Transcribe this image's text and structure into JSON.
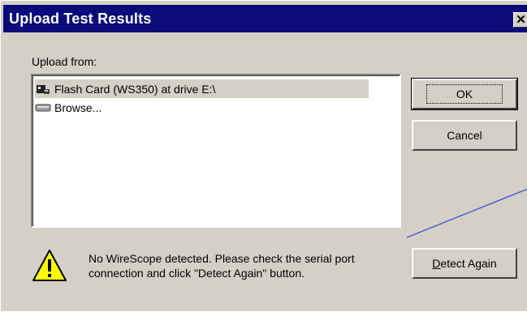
{
  "dialog": {
    "title": "Upload Test Results",
    "close_glyph": "✕",
    "upload_label": "Upload from:",
    "list_items": [
      {
        "label": "Flash Card (WS350) at drive E:\\",
        "icon": "flash-card-icon",
        "selected": true
      },
      {
        "label": "Browse...",
        "icon": "drive-icon",
        "selected": false
      }
    ],
    "ok_label": "OK",
    "cancel_label": "Cancel",
    "detect_again_underlined": "D",
    "detect_again_rest": "etect Again",
    "warning_text": "No WireScope detected. Please check the serial port connection and click \"Detect Again\" button.",
    "warning_icon": "warning-icon"
  },
  "colors": {
    "titlebar": "#0a0a7a",
    "face": "#d4d0c8",
    "annotation_line": "#3a4fd8",
    "warning_fill": "#ffff00"
  }
}
